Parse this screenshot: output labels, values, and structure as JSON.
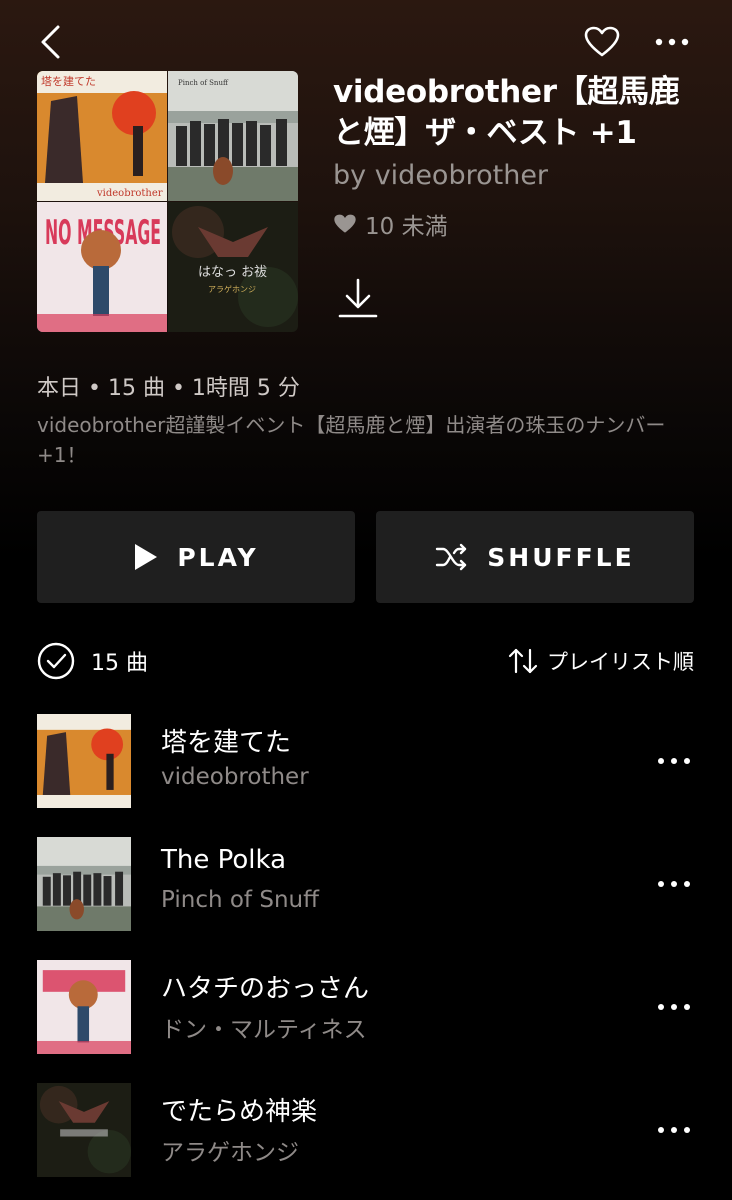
{
  "header": {
    "back_icon": "chevron-left-icon",
    "favorite_icon": "heart-outline-icon",
    "more_icon": "more-horizontal-icon"
  },
  "playlist": {
    "title": "videobrother【超馬鹿と煙】ザ・ベスト +1",
    "byline": "by videobrother",
    "likes": "10 未満",
    "meta": "本日 • 15 曲 • 1時間 5 分",
    "description": "videobrother超謹製イベント【超馬鹿と煙】出演者の珠玉のナンバー+1！"
  },
  "cover_art_text": {
    "tower_title": "塔を建てた",
    "tower_artist": "videobrother",
    "polka_label": "Pinch of Snuff",
    "message_art": "NO MESSAGE",
    "kagura_art": "はなっ お祓",
    "kagura_artist": "アラゲホンジ"
  },
  "actions": {
    "play_label": "PLAY",
    "shuffle_label": "SHUFFLE"
  },
  "list_header": {
    "count": "15 曲",
    "sort_label": "プレイリスト順"
  },
  "tracks": [
    {
      "title": "塔を建てた",
      "artist": "videobrother"
    },
    {
      "title": "The Polka",
      "artist": "Pinch of Snuff"
    },
    {
      "title": "ハタチのおっさん",
      "artist": "ドン・マルティネス"
    },
    {
      "title": "でたらめ神楽",
      "artist": "アラゲホンジ"
    }
  ],
  "colors": {
    "background": "#000000",
    "button_bg": "#1f1f1f",
    "secondary_text": "#9a9592"
  }
}
